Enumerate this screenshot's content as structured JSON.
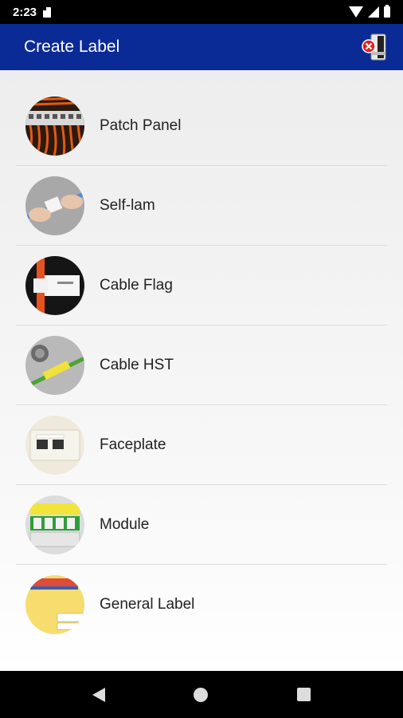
{
  "status_bar": {
    "time": "2:23"
  },
  "app_bar": {
    "title": "Create Label",
    "printer_icon": "printer-disconnected-icon"
  },
  "items": [
    {
      "label": "Patch Panel",
      "icon": "patch-panel-thumbnail"
    },
    {
      "label": "Self-lam",
      "icon": "self-lam-thumbnail"
    },
    {
      "label": "Cable Flag",
      "icon": "cable-flag-thumbnail"
    },
    {
      "label": "Cable HST",
      "icon": "cable-hst-thumbnail"
    },
    {
      "label": "Faceplate",
      "icon": "faceplate-thumbnail"
    },
    {
      "label": "Module",
      "icon": "module-thumbnail"
    },
    {
      "label": "General Label",
      "icon": "general-label-thumbnail"
    }
  ],
  "colors": {
    "app_bar": "#0a2a96",
    "background": "#f2f2f2"
  }
}
